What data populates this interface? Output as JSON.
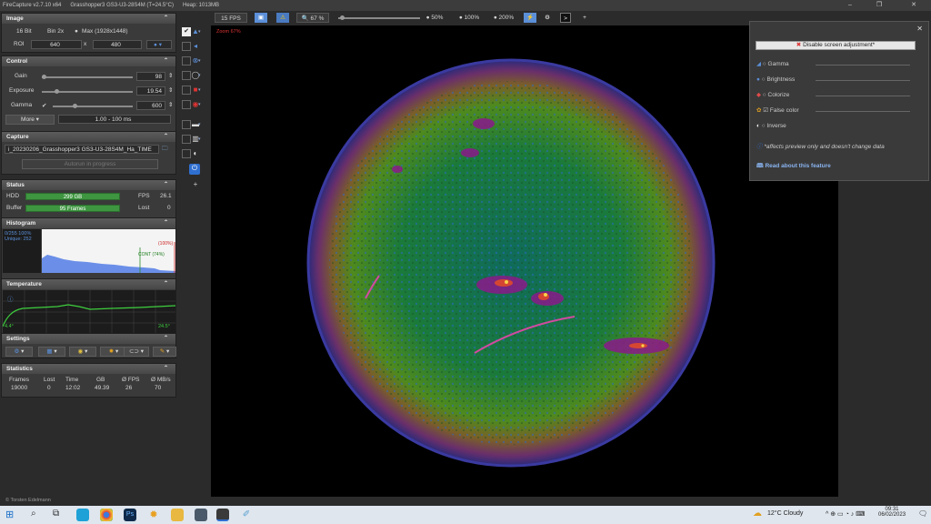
{
  "titlebar": {
    "app": "FireCapture v2.7.10 x64",
    "camera": "Grasshopper3 GS3-U3-28S4M (T=24.5°C)",
    "heap": "Heap: 1013MB"
  },
  "image": {
    "header": "Image",
    "bit": "16 Bit",
    "bin": "Bin 2x",
    "max": "Max (1928x1448)",
    "roi_label": "ROI",
    "roi_w": "640",
    "roi_x": "x",
    "roi_h": "480"
  },
  "control": {
    "header": "Control",
    "gain_label": "Gain",
    "gain_value": "98",
    "gain_level": 0.0,
    "exposure_label": "Exposure",
    "exposure_value": "19.54",
    "exposure_level": 0.15,
    "gamma_label": "Gamma",
    "gamma_value": "600",
    "gamma_level": 0.27,
    "more_label": "More",
    "range": "1.00 - 100 ms"
  },
  "capture": {
    "header": "Capture",
    "filename": "i_20230206_Grasshopper3 GS3-U3-28S4M_Ha_TIME",
    "autorun": "Autorun in progress"
  },
  "status": {
    "header": "Status",
    "hdd_label": "HDD",
    "hdd_value": "299 GB",
    "fps_label": "FPS",
    "fps_value": "26.1",
    "buffer_label": "Buffer",
    "buffer_value": "95 Frames",
    "lost_label": "Lost",
    "lost_value": "0"
  },
  "histogram": {
    "header": "Histogram",
    "line1": "0/255 100%",
    "line2": "Unique: 252",
    "cont": "CONT (74%)",
    "max_pct": "(100%)"
  },
  "temperature": {
    "header": "Temperature",
    "min": "4.4°",
    "max": "24.5°"
  },
  "settings": {
    "header": "Settings"
  },
  "statistics": {
    "header": "Statistics",
    "cols": [
      "Frames",
      "Lost",
      "Time",
      "GB",
      "Ø FPS",
      "Ø MB/s"
    ],
    "vals": [
      "19000",
      "0",
      "12:02",
      "49.39",
      "26",
      "70"
    ]
  },
  "topbar": {
    "fps": "15 FPS",
    "zoom": "67 %",
    "z50": "50%",
    "z100": "100%",
    "z200": "200%"
  },
  "viewer": {
    "zoom_label": "Zoom 67%"
  },
  "overlay": {
    "disable": "Disable screen adjustment*",
    "gamma": "Gamma",
    "brightness": "Brightness",
    "colorize": "Colorize",
    "false_color": "False color",
    "inverse": "Inverse",
    "note": "*affects preview only and doesn't change data",
    "read": "Read about this feature"
  },
  "footer": {
    "credit": "© Torsten Edelmann"
  },
  "taskbar": {
    "weather": "12°C  Cloudy",
    "time": "09:31",
    "date": "06/02/2023"
  }
}
